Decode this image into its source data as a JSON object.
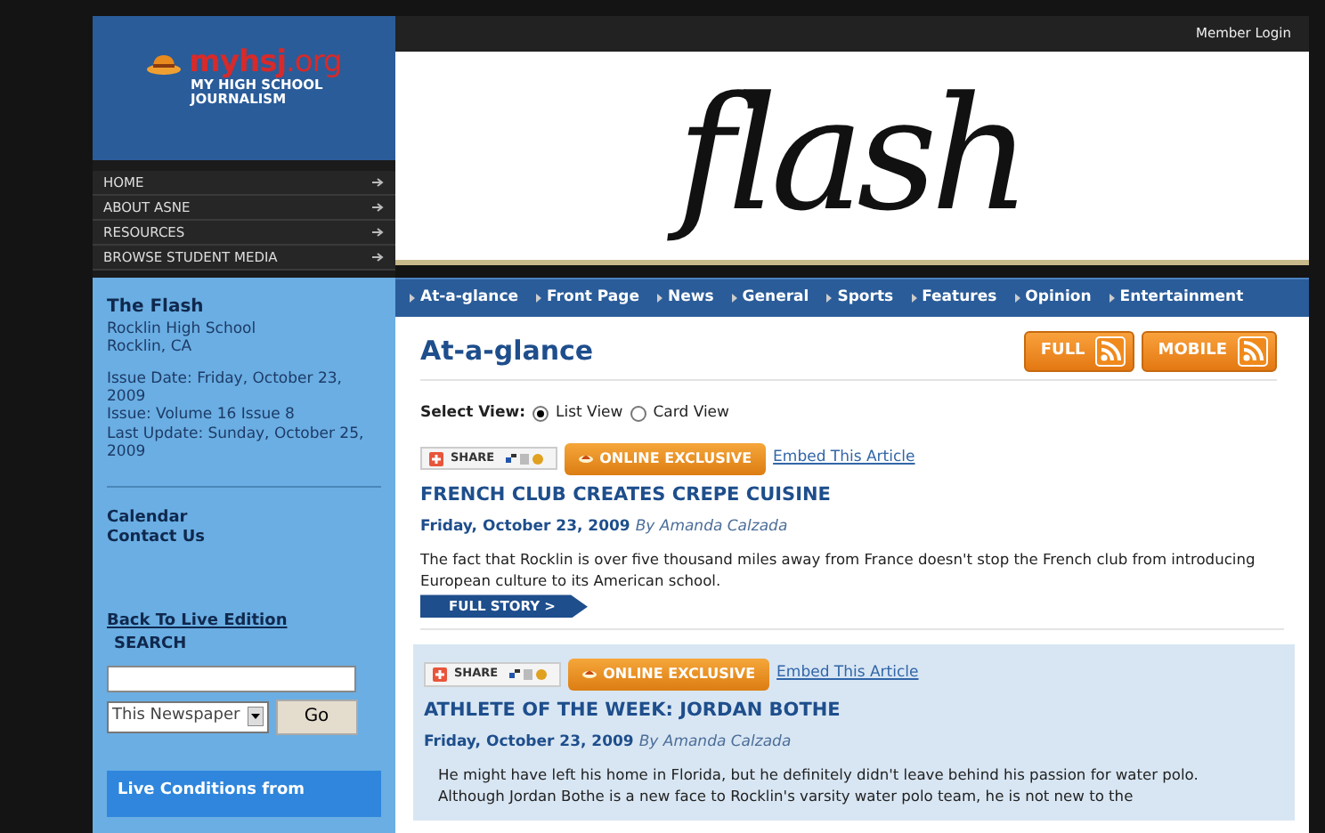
{
  "sidebar": {
    "logo": {
      "name": "**myhsj**.org",
      "tagline": "MY HIGH SCHOOL JOURNALISM"
    },
    "menu": [
      {
        "label": "HOME"
      },
      {
        "label": "ABOUT ASNE"
      },
      {
        "label": "RESOURCES"
      },
      {
        "label": "BROWSE STUDENT MEDIA"
      }
    ],
    "paper": {
      "title": "The Flash",
      "school": "Rocklin High School",
      "location": "Rocklin, CA",
      "issue_lines": [
        "Issue Date: Friday, October 23, 2009",
        "Issue: Volume 16 Issue 8",
        "Last Update: Sunday, October 25, 2009"
      ]
    },
    "links": [
      "Calendar",
      "Contact Us"
    ],
    "back_link": "Back To Live Edition",
    "search": {
      "label": "SEARCH",
      "scope": "This Newspaper",
      "button": "Go"
    },
    "live_conditions": "Live Conditions from"
  },
  "header": {
    "member_login": "Member Login",
    "masthead": "flash"
  },
  "nav": [
    "At-a-glance",
    "Front Page",
    "News",
    "General",
    "Sports",
    "Features",
    "Opinion",
    "Entertainment"
  ],
  "page": {
    "title": "At-a-glance",
    "feeds": [
      "FULL",
      "MOBILE"
    ],
    "select_view": {
      "label": "Select View:",
      "options": [
        {
          "label": "List View",
          "selected": true
        },
        {
          "label": "Card View",
          "selected": false
        }
      ]
    },
    "articles": [
      {
        "highlighted": false,
        "share": "SHARE",
        "badge": "ONLINE EXCLUSIVE",
        "embed": "Embed This Article",
        "headline": "FRENCH CLUB CREATES CREPE CUISINE",
        "date": "Friday, October 23, 2009",
        "author": "By Amanda Calzada",
        "summary": [
          "The fact that Rocklin is over five thousand miles away from France doesn't stop the French club from introducing European culture to its American school."
        ],
        "full_story": "FULL STORY >"
      },
      {
        "highlighted": true,
        "share": "SHARE",
        "badge": "ONLINE EXCLUSIVE",
        "embed": "Embed This Article",
        "headline": "ATHLETE OF THE WEEK: JORDAN BOTHE",
        "date": "Friday, October 23, 2009",
        "author": "By Amanda Calzada",
        "summary": [
          "He might have left his home in Florida, but he definitely didn't leave behind his passion for water polo.",
          "Although Jordan Bothe is a new face to Rocklin's varsity water polo team, he is not new to the"
        ]
      }
    ]
  }
}
